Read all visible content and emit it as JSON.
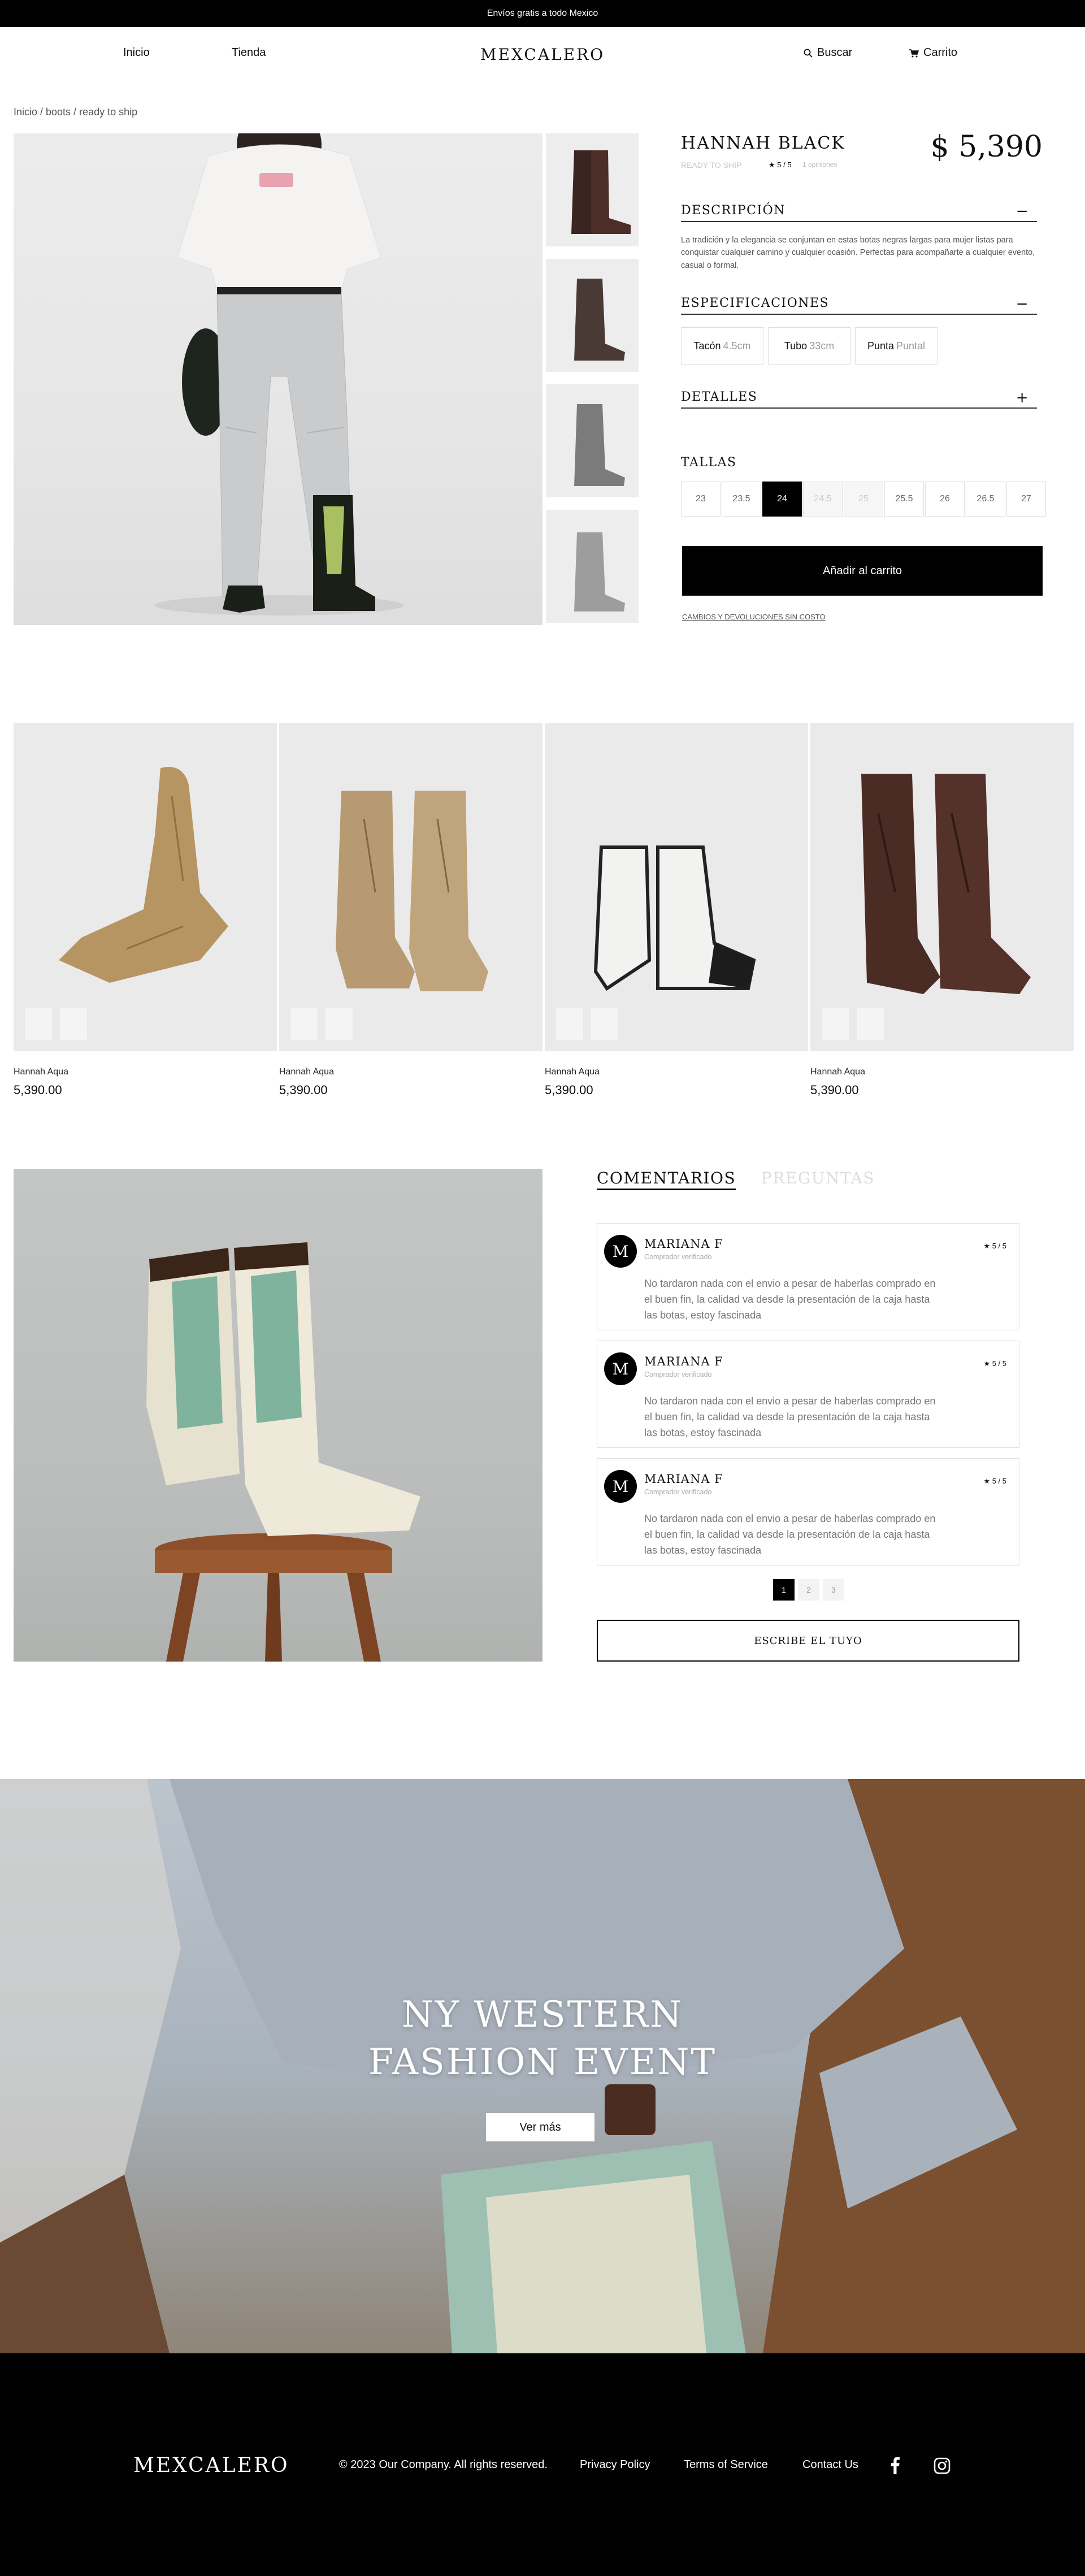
{
  "topbar": {
    "text": "Envíos gratis a todo Mexico"
  },
  "nav": {
    "inicio": "Inicio",
    "tienda": "Tienda",
    "logo": "MEXCALERO",
    "search": "Buscar",
    "cart": "Carrito"
  },
  "breadcrumb": "Inicio / boots / ready to ship",
  "product": {
    "name": "HANNAH BLACK",
    "price": "$ 5,390",
    "status": "READY TO SHIP",
    "rating": "★ 5 / 5",
    "reviews": "1 opiniones",
    "description_title": "DESCRIPCIÓN",
    "description_toggle": "−",
    "description": "La tradición y la elegancia se conjuntan en estas botas negras largas para mujer listas para conquistar cualquier camino y cualquier ocasión. Perfectas para acompañarte a cualquier evento, casual o formal.",
    "specs_title": "ESPECIFICACIONES",
    "specs_toggle": "−",
    "specs": [
      {
        "label": "Tacón",
        "value": "4.5cm"
      },
      {
        "label": "Tubo",
        "value": "33cm"
      },
      {
        "label": "Punta",
        "value": "Puntal"
      }
    ],
    "details_title": "DETALLES",
    "details_toggle": "+",
    "sizes_title": "TALLAS",
    "sizes": [
      "23",
      "23.5",
      "24",
      "24.5",
      "25",
      "25.5",
      "26",
      "26.5",
      "27"
    ],
    "selected_size": "24",
    "unavailable_sizes": [
      "24.5",
      "25"
    ],
    "add_to_cart": "Añadir al carrito",
    "returns": "CAMBIOS Y DEVOLUCIONES SIN COSTO"
  },
  "related": [
    {
      "name": "Hannah Aqua",
      "price": "5,390.00"
    },
    {
      "name": "Hannah Aqua",
      "price": "5,390.00"
    },
    {
      "name": "Hannah Aqua",
      "price": "5,390.00"
    },
    {
      "name": "Hannah Aqua",
      "price": "5,390.00"
    }
  ],
  "reviews": {
    "tab_comments": "COMENTARIOS",
    "tab_questions": "PREGUNTAS",
    "items": [
      {
        "initial": "M",
        "name": "MARIANA F",
        "badge": "Comprador verificado",
        "stars": "★ 5 / 5",
        "text": "No tardaron nada con el envio a pesar de haberlas comprado en el buen fin, la calidad va desde la presentación de la caja hasta las botas, estoy fascinada"
      },
      {
        "initial": "M",
        "name": "MARIANA F",
        "badge": "Comprador verificado",
        "stars": "★ 5 / 5",
        "text": "No tardaron nada con el envio a pesar de haberlas comprado en el buen fin, la calidad va desde la presentación de la caja hasta las botas, estoy fascinada"
      },
      {
        "initial": "M",
        "name": "MARIANA F",
        "badge": "Comprador verificado",
        "stars": "★ 5 / 5",
        "text": "No tardaron nada con el envio a pesar de haberlas comprado en el buen fin, la calidad va desde la presentación de la caja hasta las botas, estoy fascinada"
      }
    ],
    "pages": [
      "1",
      "2",
      "3"
    ],
    "current_page": "1",
    "write": "ESCRIBE EL TUYO"
  },
  "hero": {
    "title_line1": "NY WESTERN",
    "title_line2": "FASHION EVENT",
    "button": "Ver más"
  },
  "footer": {
    "logo": "MEXCALERO",
    "copyright": "© 2023 Our Company. All rights reserved.",
    "links": [
      "Privacy Policy",
      "Terms of Service",
      "Contact Us"
    ],
    "social": [
      "facebook-icon",
      "instagram-icon"
    ]
  }
}
